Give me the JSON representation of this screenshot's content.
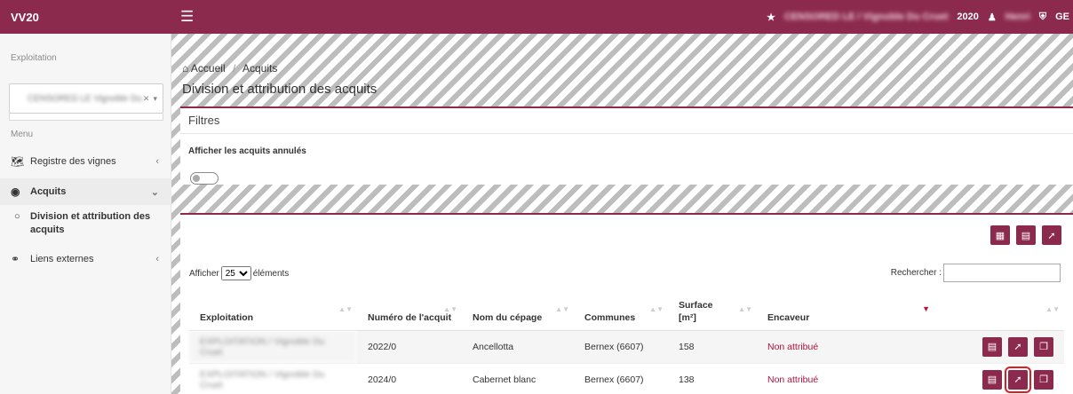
{
  "topbar": {
    "brand": "VV20",
    "menu_icon": "hamburger-icon",
    "exploitation_name": "CENSORED LE / Vignoble Du Cruet",
    "year": "2020",
    "user_name": "Henri",
    "lang": "GE"
  },
  "sidebar": {
    "exploitation_label": "Exploitation",
    "exploitation_value": "CENSORED LE Vignoble Du...",
    "menu_label": "Menu",
    "items": [
      {
        "label": "Registre des vignes",
        "icon": "map-icon"
      },
      {
        "label": "Acquits",
        "icon": "globe-icon"
      },
      {
        "label": "Liens externes",
        "icon": "link-icon"
      }
    ],
    "subitem": "Division et attribution des acquits"
  },
  "breadcrumb": {
    "home": "Accueil",
    "current": "Acquits"
  },
  "page_title": "Division et attribution des acquits",
  "filters": {
    "title": "Filtres",
    "toggle_label": "Afficher les acquits annulés"
  },
  "table_tools": {
    "show_prefix": "Afficher",
    "show_value": "25",
    "show_suffix": "éléments",
    "search_label": "Rechercher :"
  },
  "table": {
    "headers": [
      "Exploitation",
      "Numéro de l'acquit",
      "Nom du cépage",
      "Communes",
      "Surface [m²]",
      "Encaveur"
    ],
    "rows": [
      {
        "exploitation": "EXPLOITATION / Vignoble Du Cruet",
        "numero": "2022/0",
        "cepage": "Ancellotta",
        "commune": "Bernex (6607)",
        "surface": "158",
        "encaveur": "Non attribué"
      },
      {
        "exploitation": "EXPLOITATION / Vignoble Du Cruet",
        "numero": "2024/0",
        "cepage": "Cabernet blanc",
        "commune": "Bernex (6607)",
        "surface": "138",
        "encaveur": "Non attribué"
      }
    ]
  },
  "colors": {
    "brand": "#8c2a4e",
    "highlight": "#e01e1e",
    "encaveur": "#b0123c"
  }
}
